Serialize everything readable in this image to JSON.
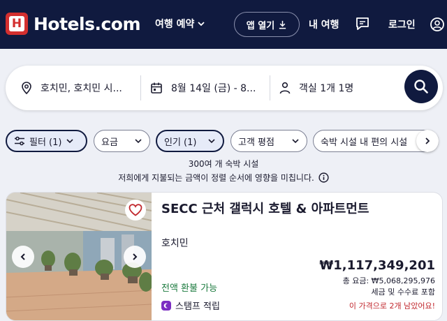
{
  "header": {
    "logo_text": "Hotels.com",
    "logo_mark": "H",
    "trips_menu": "여행 예약",
    "app_button": "앱 열기",
    "my_trips": "내 여행",
    "login": "로그인",
    "brand_color": "#101a3f",
    "logo_color": "#d32f2f"
  },
  "search": {
    "destination": "호치민, 호치민 시...",
    "dates": "8월 14일 (금) - 8...",
    "guests": "객실 1개 1명"
  },
  "filters": [
    {
      "label": "필터 (1)",
      "active": true
    },
    {
      "label": "요금",
      "active": false
    },
    {
      "label": "인기 (1)",
      "active": true
    },
    {
      "label": "고객 평점",
      "active": false
    },
    {
      "label": "숙박 시설 내 편의 시설",
      "active": false
    }
  ],
  "results": {
    "count": "300여 개 숙박 시설",
    "notice": "저희에게 지불되는 금액이 정렬 순서에 영향을 미칩니다."
  },
  "hotel": {
    "name": "SECC 근처 갤럭시 호텔 & 아파트먼트",
    "city": "호치민",
    "refund": "전액 환불 가능",
    "stamp": "스탬프 적립",
    "price": "₩1,117,349,201",
    "total": "총 요금: ₩5,068,295,976",
    "tax": "세금 및 수수료 포함",
    "rooms_left": "이 가격으로 2개 남았어요!"
  }
}
